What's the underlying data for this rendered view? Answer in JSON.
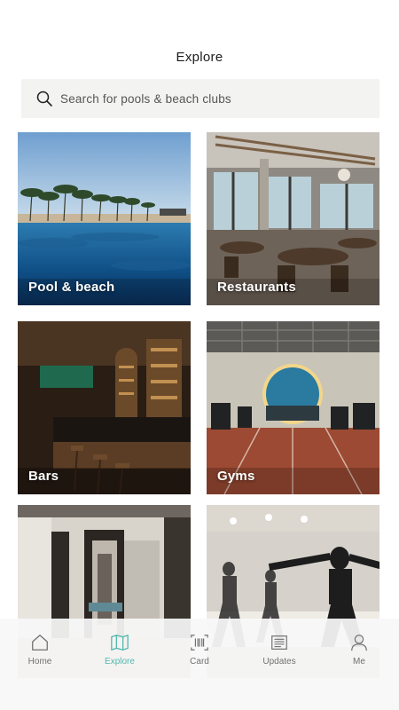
{
  "header": {
    "title": "Explore"
  },
  "search": {
    "placeholder": "Search for pools & beach clubs"
  },
  "categories": [
    {
      "label": "Pool & beach"
    },
    {
      "label": "Restaurants"
    },
    {
      "label": "Bars"
    },
    {
      "label": "Gyms"
    },
    {
      "label": ""
    },
    {
      "label": ""
    }
  ],
  "tabbar": {
    "items": [
      {
        "label": "Home",
        "icon": "home-icon",
        "active": false
      },
      {
        "label": "Explore",
        "icon": "map-icon",
        "active": true
      },
      {
        "label": "Card",
        "icon": "barcode-icon",
        "active": false
      },
      {
        "label": "Updates",
        "icon": "news-icon",
        "active": false
      },
      {
        "label": "Me",
        "icon": "user-icon",
        "active": false
      }
    ]
  },
  "colors": {
    "accent": "#4fb8ac",
    "search_bg": "#f3f3f2",
    "tab_inactive": "#707070"
  }
}
